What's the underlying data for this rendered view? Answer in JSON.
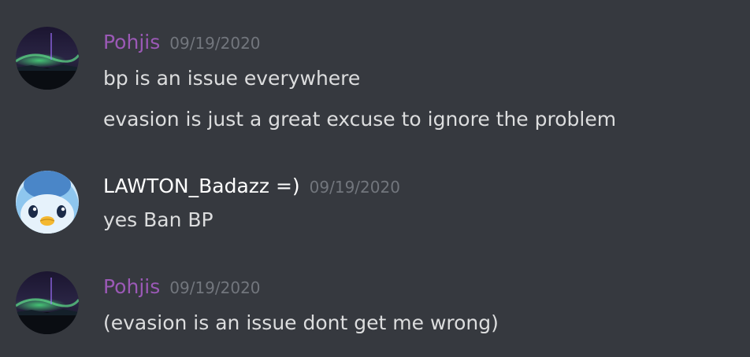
{
  "messages": [
    {
      "author": "Pohjis",
      "author_color": "#9b59b6",
      "timestamp": "09/19/2020",
      "avatar": "aurora-night-sky",
      "lines": [
        "bp is an issue everywhere",
        "evasion is just a great excuse to ignore the problem"
      ]
    },
    {
      "author": "LAWTON_Badazz =)",
      "author_color": "#ffffff",
      "timestamp": "09/19/2020",
      "avatar": "piplup-penguin",
      "lines": [
        "yes Ban BP"
      ]
    },
    {
      "author": "Pohjis",
      "author_color": "#9b59b6",
      "timestamp": "09/19/2020",
      "avatar": "aurora-night-sky",
      "lines": [
        "(evasion is an issue dont get me wrong)"
      ]
    }
  ],
  "colors": {
    "background": "#36393f",
    "message_text": "#dcddde",
    "timestamp": "#72767d"
  }
}
